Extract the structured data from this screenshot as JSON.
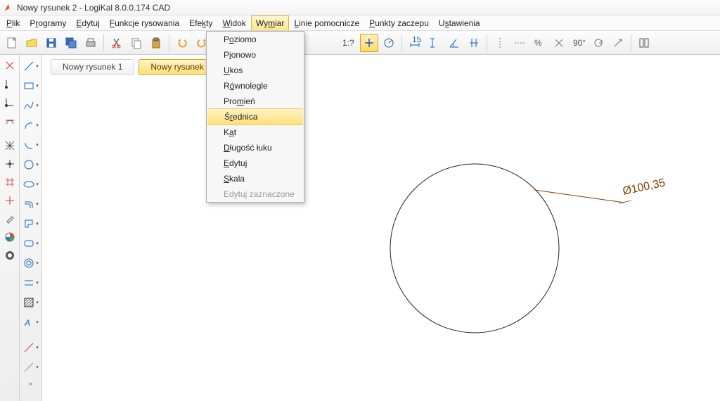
{
  "window": {
    "title": "Nowy rysunek 2 - LogiKal 8.0.0.174 CAD"
  },
  "menubar": {
    "items": [
      {
        "pre": "",
        "ul": "P",
        "post": "lik"
      },
      {
        "pre": "P",
        "ul": "r",
        "post": "ogramy"
      },
      {
        "pre": "",
        "ul": "E",
        "post": "dytuj"
      },
      {
        "pre": "",
        "ul": "F",
        "post": "unkcje rysowania"
      },
      {
        "pre": "Efe",
        "ul": "k",
        "post": "ty"
      },
      {
        "pre": "",
        "ul": "W",
        "post": "idok"
      },
      {
        "pre": "Wy",
        "ul": "m",
        "post": "iar"
      },
      {
        "pre": "",
        "ul": "L",
        "post": "inie pomocnicze"
      },
      {
        "pre": "",
        "ul": "P",
        "post": "unkty zaczepu"
      },
      {
        "pre": "U",
        "ul": "s",
        "post": "tawienia"
      }
    ],
    "open_index": 6
  },
  "dropdown": {
    "items": [
      {
        "pre": "P",
        "ul": "o",
        "post": "ziomo"
      },
      {
        "pre": "P",
        "ul": "i",
        "post": "onowo"
      },
      {
        "pre": "",
        "ul": "U",
        "post": "kos"
      },
      {
        "pre": "R",
        "ul": "ó",
        "post": "wnolegle"
      },
      {
        "pre": "Pro",
        "ul": "m",
        "post": "ień"
      },
      {
        "pre": "Ś",
        "ul": "r",
        "post": "ednica"
      },
      {
        "pre": "K",
        "ul": "ą",
        "post": "t"
      },
      {
        "pre": "",
        "ul": "D",
        "post": "ługość łuku"
      },
      {
        "pre": "",
        "ul": "E",
        "post": "dytuj"
      },
      {
        "pre": "",
        "ul": "S",
        "post": "kala"
      },
      {
        "pre": "Edytuj zaznaczone",
        "ul": "",
        "post": ""
      }
    ],
    "highlight_index": 5,
    "disabled_index": 10
  },
  "toolbar": {
    "scale_label": "1:?"
  },
  "tabs": {
    "items": [
      {
        "label": "Nowy rysunek 1",
        "active": false
      },
      {
        "label": "Nowy rysunek 2",
        "active": true
      }
    ],
    "close_glyph": "⊗"
  },
  "canvas": {
    "dimension_label": "Ø100,35"
  }
}
